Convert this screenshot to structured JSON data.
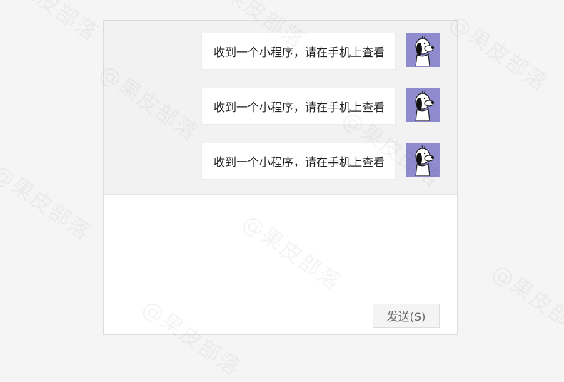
{
  "messages": [
    {
      "text": "收到一个小程序，请在手机上查看"
    },
    {
      "text": "收到一个小程序，请在手机上查看"
    },
    {
      "text": "收到一个小程序，请在手机上查看"
    }
  ],
  "input": {
    "send_label": "发送(S)"
  },
  "watermark": "@果皮部落",
  "colors": {
    "page_bg": "#f5f5f5",
    "message_area_bg": "#f2f2f2",
    "avatar_bg": "#8e8ccf",
    "bubble_bg": "#ffffff"
  }
}
